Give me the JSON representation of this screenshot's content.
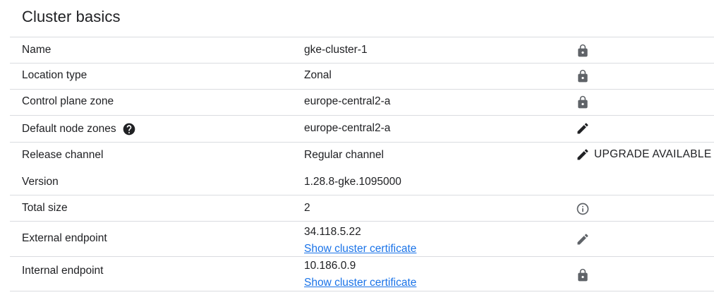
{
  "section": {
    "title": "Cluster basics"
  },
  "rows": [
    {
      "label": "Name",
      "value": "gke-cluster-1",
      "icon": "lock-icon"
    },
    {
      "label": "Location type",
      "value": "Zonal",
      "icon": "lock-icon"
    },
    {
      "label": "Control plane zone",
      "value": "europe-central2-a",
      "icon": "lock-icon"
    },
    {
      "label": "Default node zones",
      "value": "europe-central2-a",
      "icon": "edit-icon",
      "help_icon": "help-icon"
    },
    {
      "label": "Release channel",
      "value": "Regular channel",
      "icon": "edit-icon",
      "action_label": "UPGRADE AVAILABLE"
    },
    {
      "label": "Version",
      "value": "1.28.8-gke.1095000"
    },
    {
      "label": "Total size",
      "value": "2",
      "icon": "info-icon"
    },
    {
      "label": "External endpoint",
      "value": "34.118.5.22",
      "link": "Show cluster certificate",
      "icon": "edit-icon"
    },
    {
      "label": "Internal endpoint",
      "value": "10.186.0.9",
      "link": "Show cluster certificate",
      "icon": "lock-icon"
    }
  ],
  "colors": {
    "text": "#202124",
    "icon_muted": "#5f6368",
    "link": "#1a73e8",
    "divider": "#dadce0"
  }
}
